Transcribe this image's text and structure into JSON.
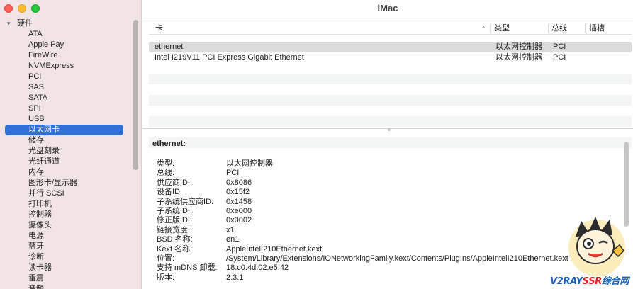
{
  "window": {
    "title": "iMac"
  },
  "sidebar": {
    "section": "硬件",
    "items": [
      "ATA",
      "Apple Pay",
      "FireWire",
      "NVMExpress",
      "PCI",
      "SAS",
      "SATA",
      "SPI",
      "USB",
      "以太网卡",
      "储存",
      "光盘刻录",
      "光纤通道",
      "内存",
      "图形卡/显示器",
      "并行 SCSI",
      "打印机",
      "控制器",
      "摄像头",
      "电源",
      "蓝牙",
      "诊断",
      "读卡器",
      "雷雳",
      "音频"
    ],
    "selected_index": 9
  },
  "table": {
    "headers": {
      "card": "卡",
      "type": "类型",
      "bus": "总线",
      "slot": "插槽"
    },
    "rows": [
      {
        "card": "ethernet",
        "type": "以太网控制器",
        "bus": "PCI"
      },
      {
        "card": "Intel I219V11 PCI Express Gigabit Ethernet",
        "type": "以太网控制器",
        "bus": "PCI"
      }
    ],
    "selected_row": 0
  },
  "detail": {
    "title": "ethernet:",
    "properties": [
      {
        "key": "类型:",
        "value": "以太网控制器"
      },
      {
        "key": "总线:",
        "value": "PCI"
      },
      {
        "key": "供应商ID:",
        "value": "0x8086"
      },
      {
        "key": "设备ID:",
        "value": "0x15f2"
      },
      {
        "key": "子系统供应商ID:",
        "value": "0x1458"
      },
      {
        "key": "子系统ID:",
        "value": "0xe000"
      },
      {
        "key": "修正版ID:",
        "value": "0x0002"
      },
      {
        "key": "链接宽度:",
        "value": "x1"
      },
      {
        "key": "BSD 名称:",
        "value": "en1"
      },
      {
        "key": "Kext 名称:",
        "value": "AppleIntelI210Ethernet.kext"
      },
      {
        "key": "位置:",
        "value": "/System/Library/Extensions/IONetworkingFamily.kext/Contents/PlugIns/AppleIntelI210Ethernet.kext"
      },
      {
        "key": "支持 mDNS 卸载:",
        "value": "18:c0:4d:02:e5:42"
      },
      {
        "key": "版本:",
        "value": "2.3.1"
      }
    ]
  },
  "watermark": {
    "part1": "V2RAY",
    "part2": "SSR",
    "part3": "综合网"
  },
  "colors": {
    "selection": "#2f6fd6",
    "sidebar_bg": "#f1e4e5"
  }
}
